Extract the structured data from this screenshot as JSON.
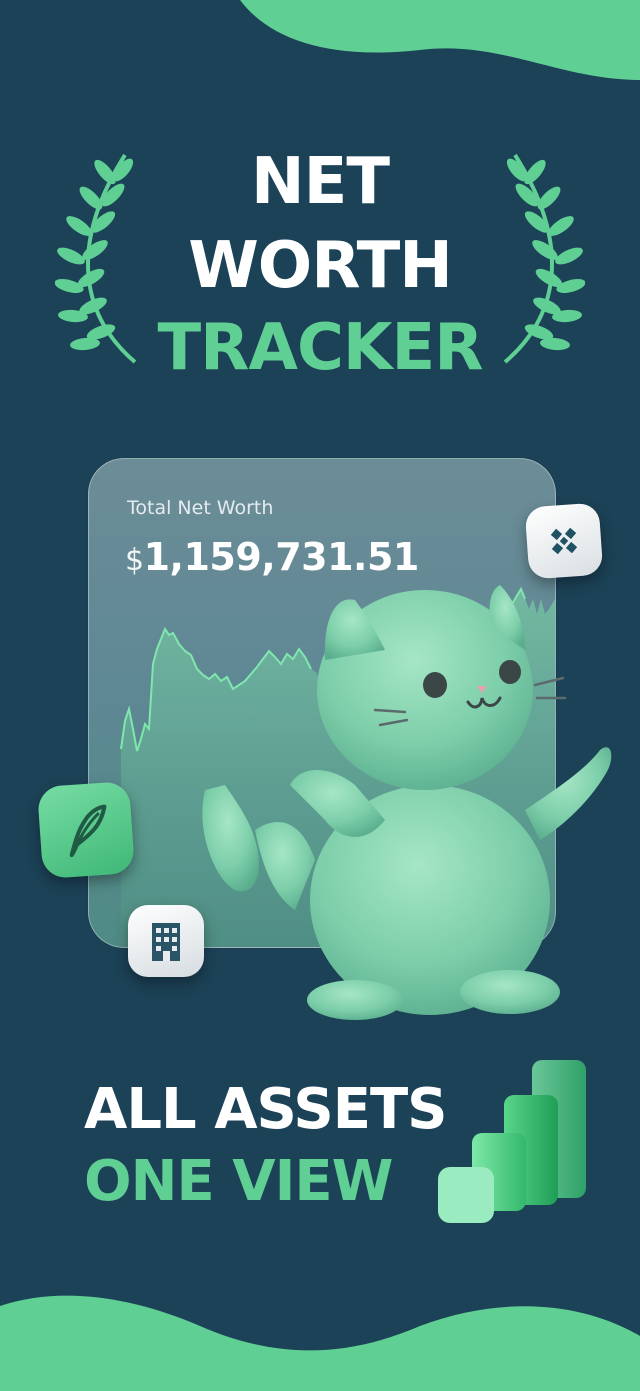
{
  "title": {
    "line1": "NET",
    "line2": "WORTH",
    "line3": "TRACKER"
  },
  "card": {
    "label": "Total Net Worth",
    "currency": "$",
    "amount": "1,159,731.51"
  },
  "icons": {
    "binance": "binance-icon",
    "robinhood": "robinhood-feather-icon",
    "bank": "bank-building-icon"
  },
  "bottom": {
    "line1": "ALL ASSETS",
    "line2": "ONE VIEW"
  },
  "colors": {
    "background": "#1c4257",
    "accent": "#5fcf93",
    "text": "#ffffff"
  }
}
